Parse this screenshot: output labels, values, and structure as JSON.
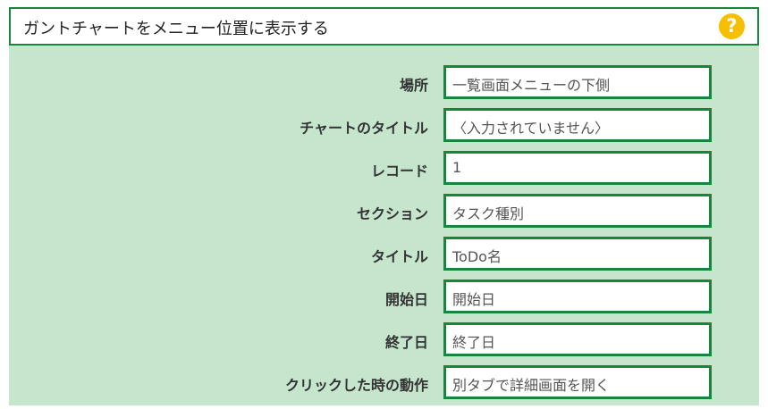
{
  "header": {
    "title": "ガントチャートをメニュー位置に表示する",
    "help_symbol": "?"
  },
  "fields": [
    {
      "label": "場所",
      "value": "一覧画面メニューの下側"
    },
    {
      "label": "チャートのタイトル",
      "value": "〈入力されていません〉"
    },
    {
      "label": "レコード",
      "value": "1"
    },
    {
      "label": "セクション",
      "value": "タスク種別"
    },
    {
      "label": "タイトル",
      "value": "ToDo名"
    },
    {
      "label": "開始日",
      "value": "開始日"
    },
    {
      "label": "終了日",
      "value": "終了日"
    },
    {
      "label": "クリックした時の動作",
      "value": "別タブで詳細画面を開く"
    }
  ],
  "colors": {
    "panel_background": "#c5e5cc",
    "border_green": "#17853a",
    "help_icon": "#f7bf00"
  }
}
